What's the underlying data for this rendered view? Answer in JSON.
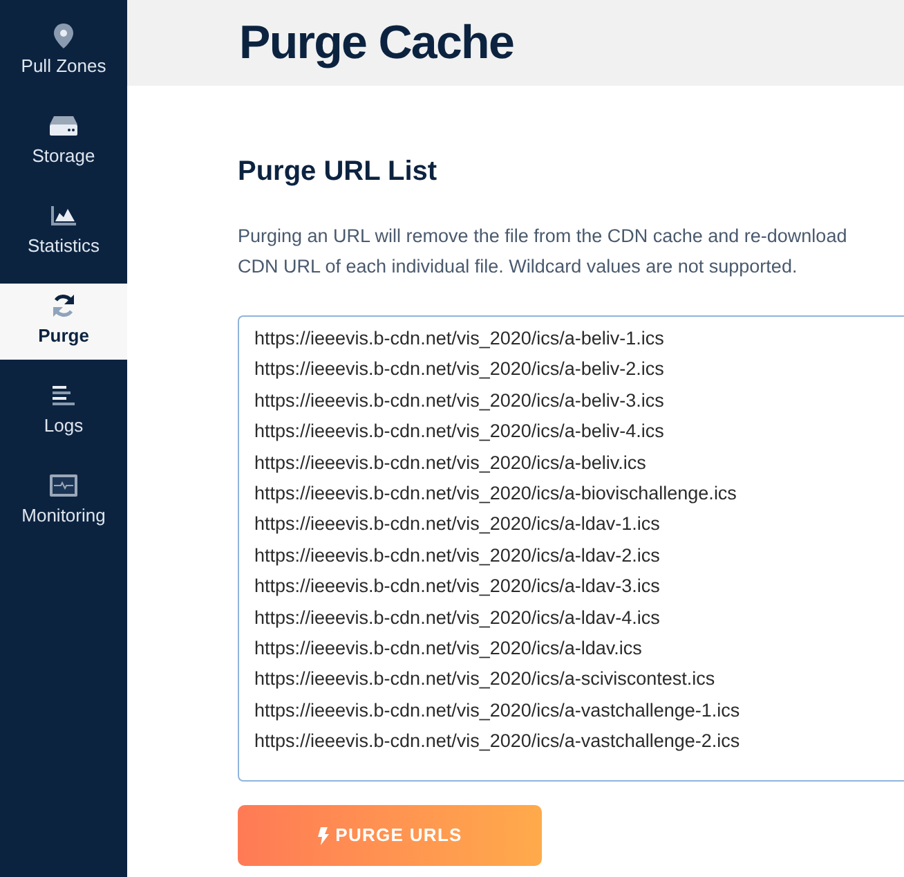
{
  "sidebar": {
    "items": [
      {
        "label": "Pull Zones",
        "selected": false
      },
      {
        "label": "Storage",
        "selected": false
      },
      {
        "label": "Statistics",
        "selected": false
      },
      {
        "label": "Purge",
        "selected": true
      },
      {
        "label": "Logs",
        "selected": false
      },
      {
        "label": "Monitoring",
        "selected": false
      }
    ]
  },
  "page_title": "Purge Cache",
  "section": {
    "title": "Purge URL List",
    "description_lines": [
      "Purging an URL will remove the file from the CDN cache and re-download",
      "CDN URL of each individual file. Wildcard values are not supported."
    ],
    "urls": [
      "https://ieeevis.b-cdn.net/vis_2020/ics/a-beliv-1.ics",
      "https://ieeevis.b-cdn.net/vis_2020/ics/a-beliv-2.ics",
      "https://ieeevis.b-cdn.net/vis_2020/ics/a-beliv-3.ics",
      "https://ieeevis.b-cdn.net/vis_2020/ics/a-beliv-4.ics",
      "https://ieeevis.b-cdn.net/vis_2020/ics/a-beliv.ics",
      "https://ieeevis.b-cdn.net/vis_2020/ics/a-biovischallenge.ics",
      "https://ieeevis.b-cdn.net/vis_2020/ics/a-ldav-1.ics",
      "https://ieeevis.b-cdn.net/vis_2020/ics/a-ldav-2.ics",
      "https://ieeevis.b-cdn.net/vis_2020/ics/a-ldav-3.ics",
      "https://ieeevis.b-cdn.net/vis_2020/ics/a-ldav-4.ics",
      "https://ieeevis.b-cdn.net/vis_2020/ics/a-ldav.ics",
      "https://ieeevis.b-cdn.net/vis_2020/ics/a-sciviscontest.ics",
      "https://ieeevis.b-cdn.net/vis_2020/ics/a-vastchallenge-1.ics",
      "https://ieeevis.b-cdn.net/vis_2020/ics/a-vastchallenge-2.ics"
    ],
    "button": "PURGE URLS"
  }
}
